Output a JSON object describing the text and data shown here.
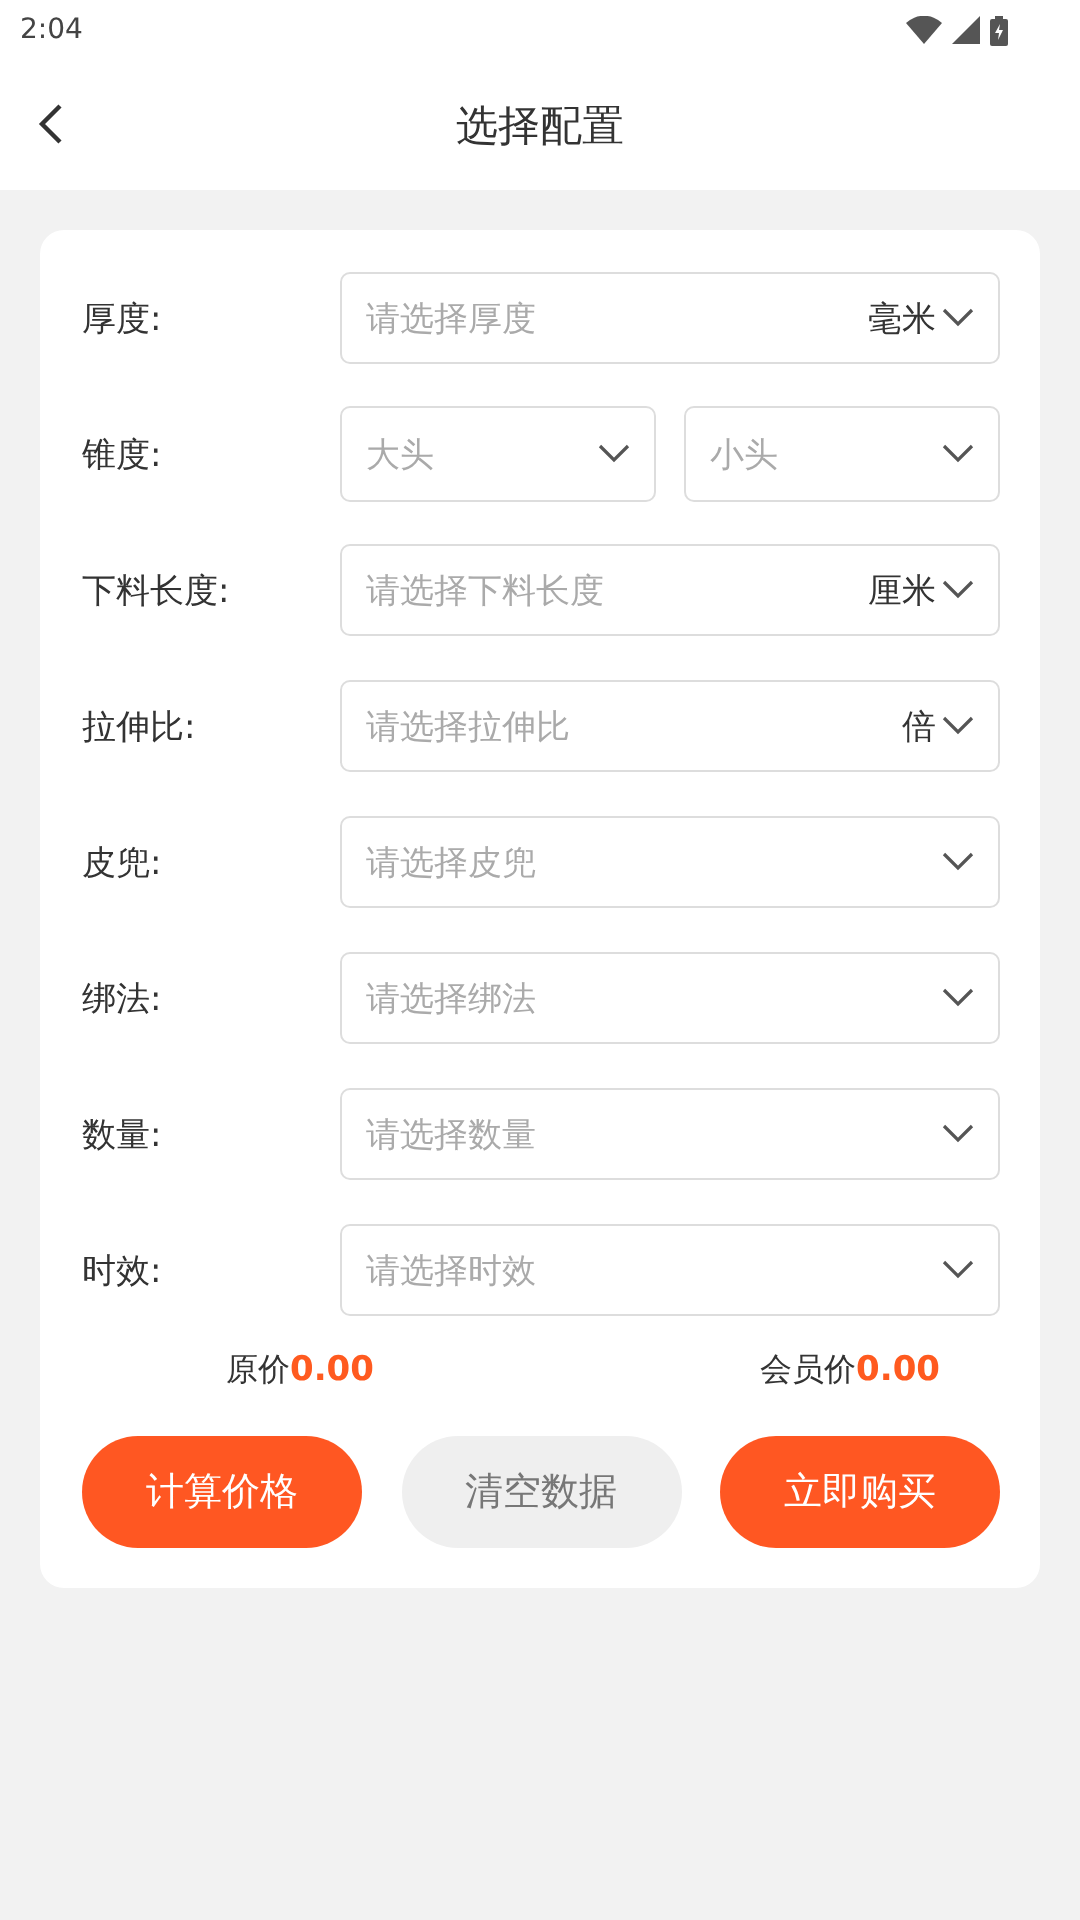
{
  "status_bar": {
    "time": "2:04"
  },
  "header": {
    "title": "选择配置"
  },
  "form": {
    "rows": [
      {
        "kind": "select",
        "label": "厚度:",
        "placeholder": "请选择厚度",
        "unit": "毫米"
      },
      {
        "kind": "double",
        "label": "锥度:",
        "fields": [
          {
            "placeholder": "大头"
          },
          {
            "placeholder": "小头"
          }
        ]
      },
      {
        "kind": "select",
        "label": "下料长度:",
        "placeholder": "请选择下料长度",
        "unit": "厘米"
      },
      {
        "kind": "select",
        "label": "拉伸比:",
        "placeholder": "请选择拉伸比",
        "unit": "倍"
      },
      {
        "kind": "select",
        "label": "皮兜:",
        "placeholder": "请选择皮兜"
      },
      {
        "kind": "select",
        "label": "绑法:",
        "placeholder": "请选择绑法"
      },
      {
        "kind": "select",
        "label": "数量:",
        "placeholder": "请选择数量"
      },
      {
        "kind": "select",
        "label": "时效:",
        "placeholder": "请选择时效"
      }
    ]
  },
  "prices": [
    {
      "label": "原价",
      "value": "0.00"
    },
    {
      "label": "会员价",
      "value": "0.00"
    }
  ],
  "buttons": [
    {
      "label": "计算价格",
      "kind": "primary"
    },
    {
      "label": "清空数据",
      "kind": "secondary"
    },
    {
      "label": "立即购买",
      "kind": "primary"
    }
  ]
}
